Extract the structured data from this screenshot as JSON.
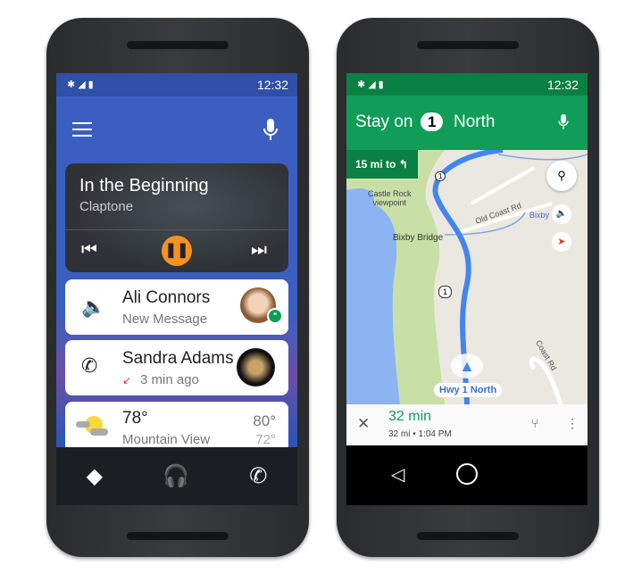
{
  "left": {
    "status": {
      "time": "12:32",
      "icons": [
        "bluetooth-icon",
        "signal-icon",
        "battery-icon"
      ]
    },
    "media": {
      "title": "In the Beginning",
      "artist": "Claptone",
      "accent": "#f6921e"
    },
    "message": {
      "name": "Ali Connors",
      "detail": "New Message"
    },
    "call": {
      "name": "Sandra Adams",
      "detail": "3 min ago"
    },
    "weather": {
      "temp": "78°",
      "location": "Mountain View",
      "high": "80°",
      "low": "72°"
    },
    "colors": {
      "background": "#3b63c4",
      "nav": "#1b1f24"
    }
  },
  "right": {
    "status": {
      "time": "12:32"
    },
    "header": {
      "prefix": "Stay on",
      "route": "1",
      "suffix": "North"
    },
    "next_turn": "15 mi to",
    "map": {
      "labels": [
        "Castle Rock",
        "viewpoint",
        "Old Coast Rd",
        "Bixby Bridge",
        "Bixby",
        "Coast Rd"
      ],
      "shields": [
        "1",
        "1"
      ],
      "current_road": "Hwy 1 North"
    },
    "trip": {
      "eta_time": "32 min",
      "distance": "32 mi",
      "arrival": "1:04 PM"
    },
    "colors": {
      "header": "#0f9d58",
      "status": "#0b8043",
      "route": "#4285f4"
    }
  }
}
